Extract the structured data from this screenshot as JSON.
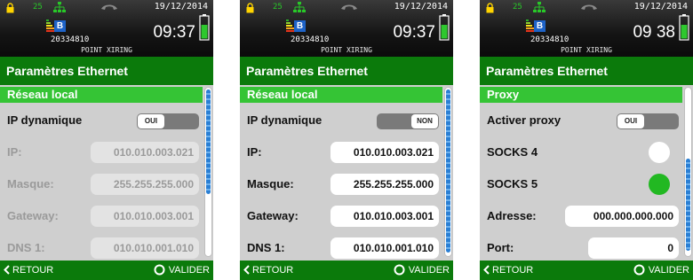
{
  "colors": {
    "header_green": "#0b7a0b",
    "section_green": "#35c435",
    "content_grey": "#cfcfcf",
    "radio_selected": "#22b822",
    "scroll_blue": "#2a7fd4"
  },
  "screens": [
    {
      "status": {
        "signal": "25",
        "date": "19/12/2014",
        "badge": "B",
        "device_number": "20334810",
        "time": "09:37",
        "terminal": "POINT XIRING"
      },
      "title": "Paramètres Ethernet",
      "section": "Réseau local",
      "toggle": {
        "label": "IP dynamique",
        "value": "OUI",
        "state": "on"
      },
      "fields": [
        {
          "label": "IP:",
          "value": "010.010.003.021"
        },
        {
          "label": "Masque:",
          "value": "255.255.255.000"
        },
        {
          "label": "Gateway:",
          "value": "010.010.003.001"
        },
        {
          "label": "DNS 1:",
          "value": "010.010.001.010"
        }
      ],
      "fields_disabled": true,
      "footer": {
        "back": "RETOUR",
        "validate": "VALIDER"
      }
    },
    {
      "status": {
        "signal": "25",
        "date": "19/12/2014",
        "badge": "B",
        "device_number": "20334810",
        "time": "09:37",
        "terminal": "POINT XIRING"
      },
      "title": "Paramètres Ethernet",
      "section": "Réseau local",
      "toggle": {
        "label": "IP dynamique",
        "value": "NON",
        "state": "off"
      },
      "fields": [
        {
          "label": "IP:",
          "value": "010.010.003.021"
        },
        {
          "label": "Masque:",
          "value": "255.255.255.000"
        },
        {
          "label": "Gateway:",
          "value": "010.010.003.001"
        },
        {
          "label": "DNS 1:",
          "value": "010.010.001.010"
        }
      ],
      "fields_disabled": false,
      "footer": {
        "back": "RETOUR",
        "validate": "VALIDER"
      }
    },
    {
      "status": {
        "signal": "25",
        "date": "19/12/2014",
        "badge": "B",
        "device_number": "20334810",
        "time": "09 38",
        "terminal": "POINT XIRING"
      },
      "title": "Paramètres Ethernet",
      "section": "Proxy",
      "toggle": {
        "label": "Activer proxy",
        "value": "OUI",
        "state": "on"
      },
      "radios": [
        {
          "label": "SOCKS 4",
          "selected": false
        },
        {
          "label": "SOCKS 5",
          "selected": true
        }
      ],
      "fields": [
        {
          "label": "Adresse:",
          "value": "000.000.000.000"
        },
        {
          "label": "Port:",
          "value": "0"
        }
      ],
      "fields_disabled": false,
      "footer": {
        "back": "RETOUR",
        "validate": "VALIDER"
      }
    }
  ]
}
